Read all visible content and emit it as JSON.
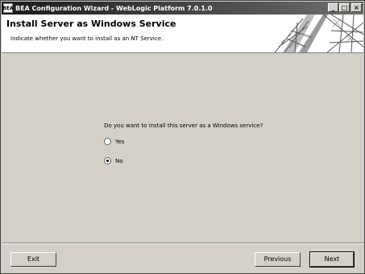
{
  "window": {
    "title": "BEA Configuration Wizard - WebLogic Platform 7.0.1.0",
    "icon_text": "BEA",
    "controls": [
      "_",
      "□",
      "×"
    ]
  },
  "header": {
    "title": "Install Server as Windows Service",
    "subtitle": "Indicate whether you want to install as an NT Service."
  },
  "form": {
    "question": "Do you want to install this server as a Windows service?",
    "options": [
      {
        "label": "Yes",
        "selected": false
      },
      {
        "label": "No",
        "selected": true
      }
    ]
  },
  "footer": {
    "exit_label": "Exit",
    "previous_label": "Previous",
    "next_label": "Next"
  }
}
